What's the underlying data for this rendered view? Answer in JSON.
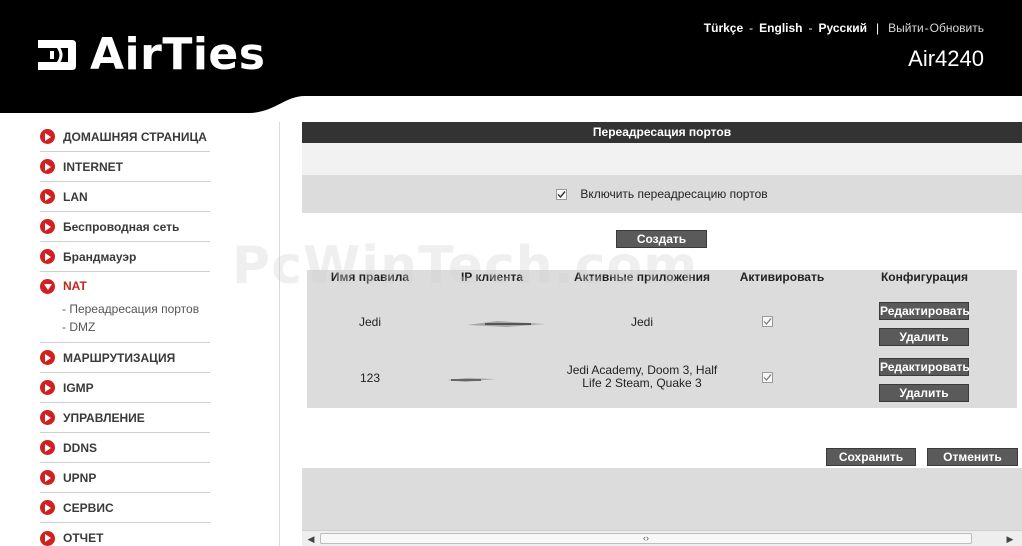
{
  "header": {
    "logo_text": "AirTies",
    "languages": [
      "Türkçe",
      "English",
      "Русский"
    ],
    "logout": "Выйти",
    "refresh": "Обновить",
    "model": "Air4240"
  },
  "sidebar": {
    "items": [
      {
        "label": "ДОМАШНЯЯ СТРАНИЦА"
      },
      {
        "label": "INTERNET"
      },
      {
        "label": "LAN"
      },
      {
        "label": "Беспроводная сеть"
      },
      {
        "label": "Брандмауэр"
      },
      {
        "label": "NAT"
      },
      {
        "label": "МАРШРУТИЗАЦИЯ"
      },
      {
        "label": "IGMP"
      },
      {
        "label": "УПРАВЛЕНИЕ"
      },
      {
        "label": "DDNS"
      },
      {
        "label": "UPNP"
      },
      {
        "label": "СЕРВИС"
      },
      {
        "label": "ОТЧЕТ"
      }
    ],
    "nat_sub": [
      "- Переадресация портов",
      "- DMZ"
    ]
  },
  "main": {
    "title": "Переадресация портов",
    "enable_label": "Включить переадресацию портов",
    "enable_checked": true,
    "create_label": "Создать",
    "columns": [
      "Имя правила",
      "IP клиента",
      "Активные приложения",
      "Активировать",
      "Конфигурация"
    ],
    "rows": [
      {
        "name": "Jedi",
        "apps_line1": "Jedi",
        "apps_line2": "",
        "active": true
      },
      {
        "name": "123",
        "apps_line1": "Jedi Academy, Doom 3, Half",
        "apps_line2": "Life 2 Steam, Quake 3",
        "active": true
      }
    ],
    "edit_label": "Редактировать",
    "delete_label": "Удалить",
    "save_label": "Сохранить",
    "cancel_label": "Отменить"
  },
  "watermark": "PcWinTech.com",
  "colors": {
    "accent": "#d1201f",
    "header_bg": "#000000",
    "button_bg": "#5a5a5a"
  }
}
